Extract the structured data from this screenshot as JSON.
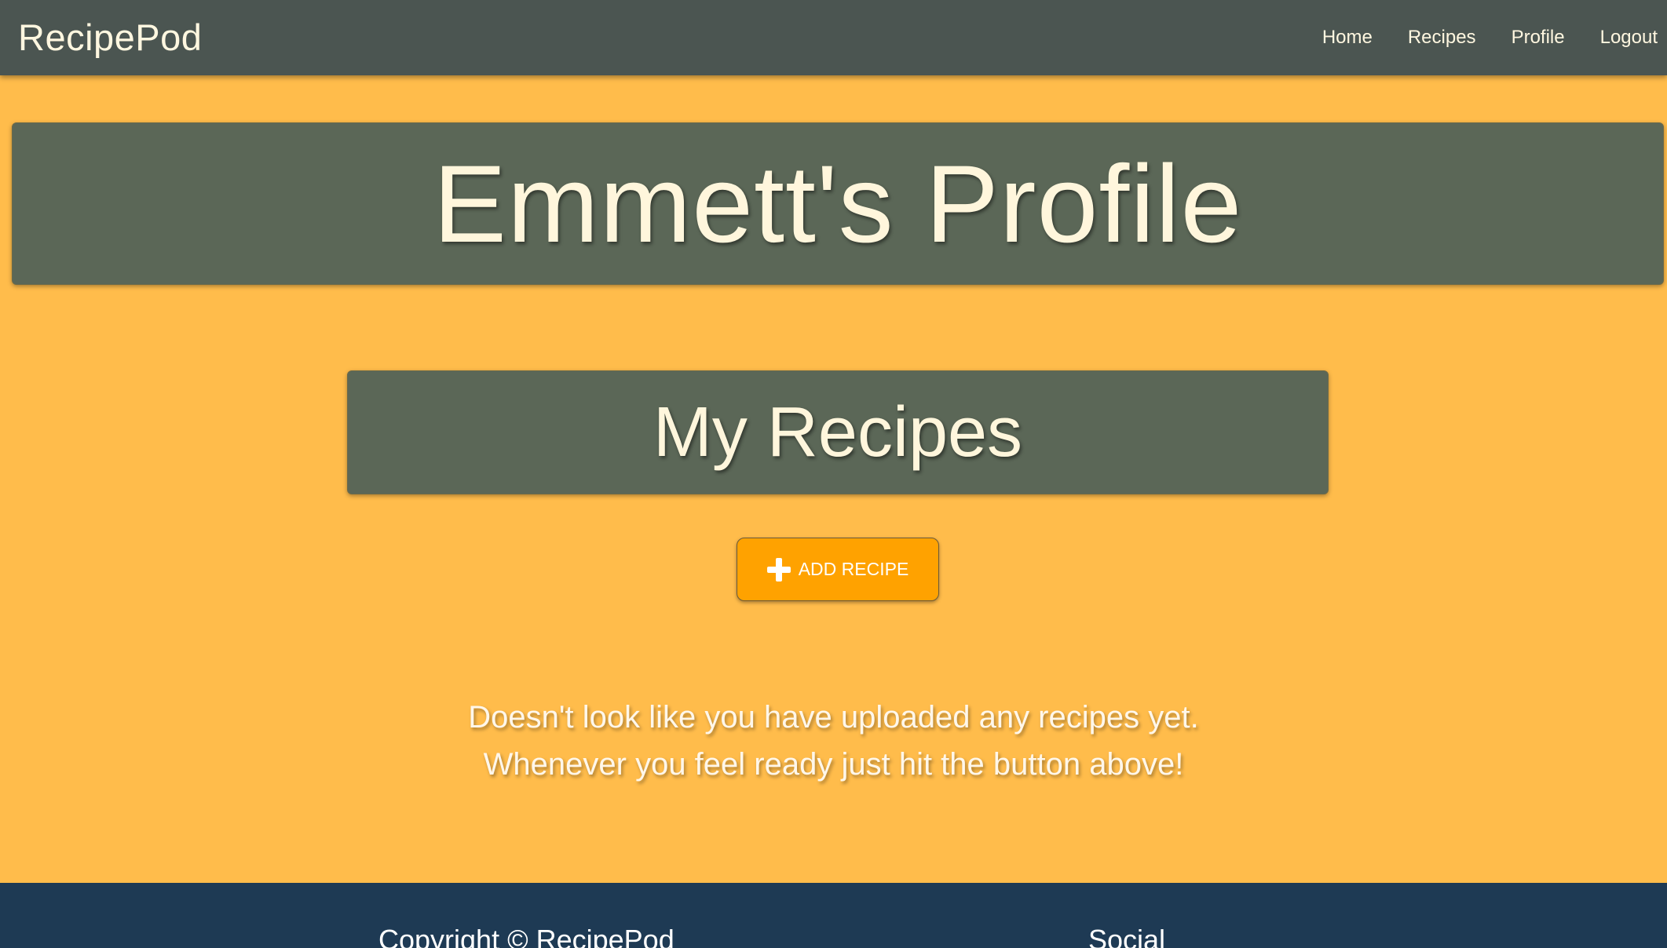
{
  "navbar": {
    "brand": "RecipePod",
    "links": [
      {
        "label": "Home"
      },
      {
        "label": "Recipes"
      },
      {
        "label": "Profile"
      },
      {
        "label": "Logout"
      }
    ]
  },
  "hero": {
    "title": "Emmett's Profile"
  },
  "recipes_section": {
    "heading": "My Recipes",
    "add_button": {
      "icon": "plus-icon",
      "label": "ADD RECIPE"
    },
    "empty_message_line1": "Doesn't look like you have uploaded any recipes yet.",
    "empty_message_line2": "Whenever you feel ready just hit the button above!"
  },
  "footer": {
    "copyright": "Copyright © RecipePod",
    "social_heading": "Social"
  },
  "colors": {
    "page_background": "#ffbc4b",
    "navbar_background": "#4b5551",
    "panel_background": "#5b6757",
    "button_background": "#ffa200",
    "footer_background": "#1e3a54",
    "text_cream": "#fff6dc"
  }
}
